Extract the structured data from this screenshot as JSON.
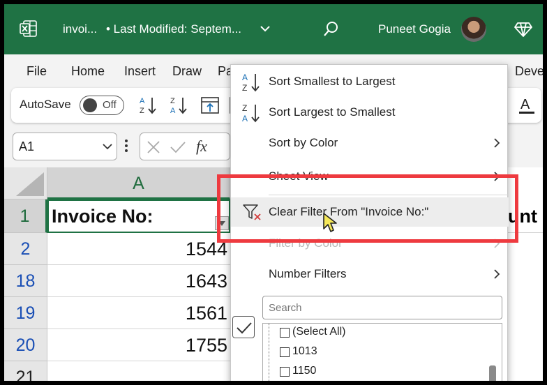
{
  "titlebar": {
    "filename": "invoi...",
    "last_modified": "• Last Modified: Septem...",
    "user_name": "Puneet Gogia",
    "app_icon": "excel-icon",
    "accent": "#1f7244"
  },
  "ribbon": {
    "tabs": [
      "File",
      "Home",
      "Insert",
      "Draw",
      "Pa",
      "Deve"
    ]
  },
  "toolbar": {
    "autosave_label": "AutoSave",
    "autosave_state": "Off"
  },
  "formula_bar": {
    "name_box": "A1",
    "fx_label": "fx"
  },
  "grid": {
    "column_header": "A",
    "row_numbers": [
      "1",
      "2",
      "18",
      "19",
      "20",
      "21"
    ],
    "header_cell": "Invoice No:",
    "next_column_partial": "unt",
    "values": [
      "1544",
      "1643",
      "1561",
      "1755"
    ]
  },
  "menu": {
    "sort_asc": "Sort Smallest to Largest",
    "sort_desc": "Sort Largest to Smallest",
    "sort_color": "Sort by Color",
    "sheet_view": "Sheet View",
    "clear_filter": "Clear Filter From \"Invoice No:\"",
    "filter_color": "Filter by Color",
    "number_filters": "Number Filters",
    "search_placeholder": "Search",
    "list": [
      "(Select All)",
      "1013",
      "1150"
    ]
  },
  "colors": {
    "highlight": "#ee3a3f",
    "row_number": "#1a4fb5"
  }
}
